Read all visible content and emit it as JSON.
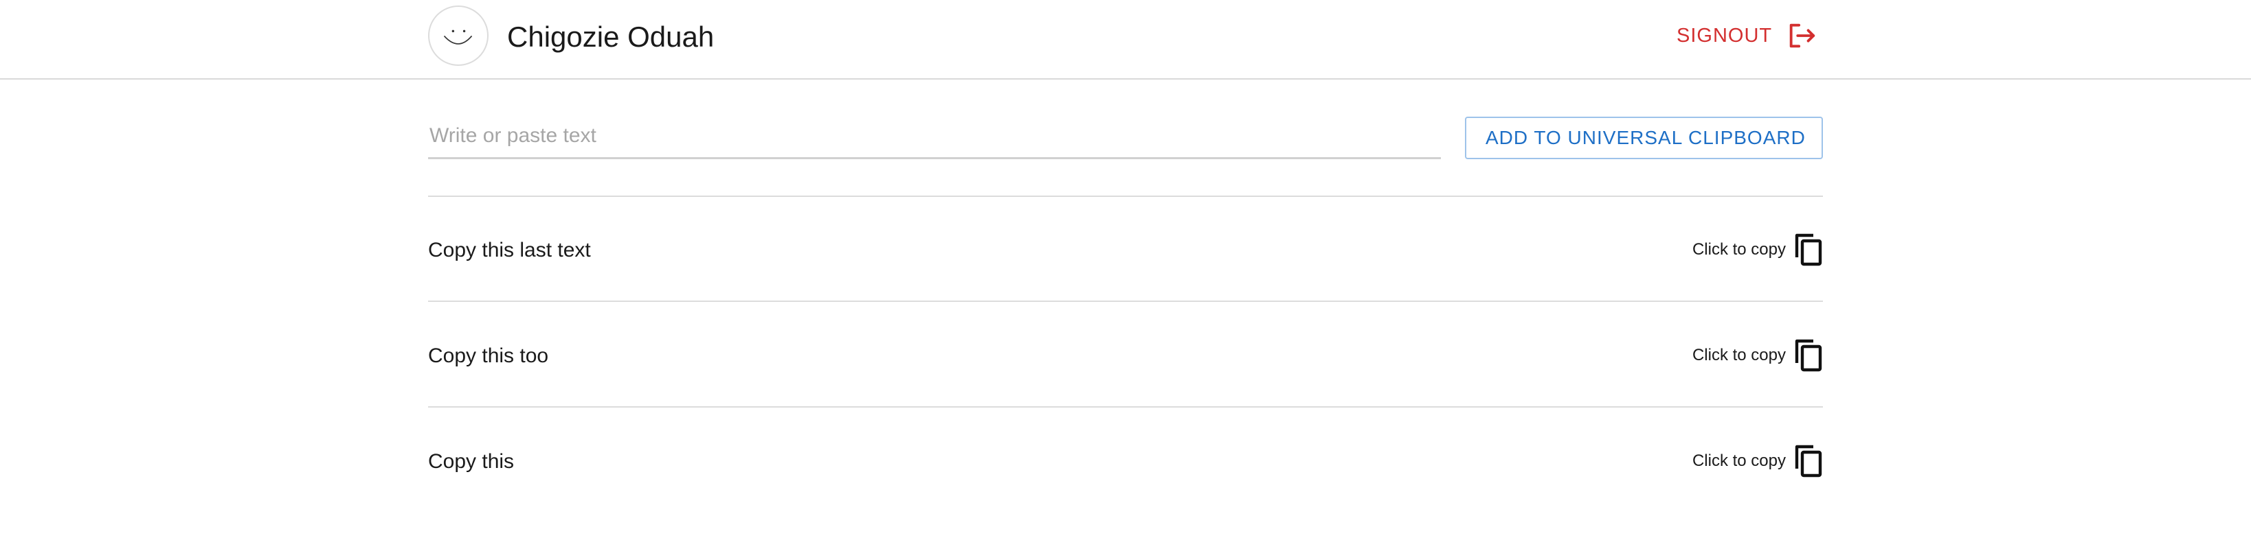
{
  "header": {
    "user_name": "Chigozie Oduah",
    "avatar_icon": "smiley-face-icon",
    "signout_label": "SIGNOUT",
    "signout_icon": "logout-icon",
    "signout_color": "#d32f2f"
  },
  "composer": {
    "placeholder": "Write or paste text",
    "value": "",
    "add_button_label": "ADD TO UNIVERSAL CLIPBOARD",
    "add_button_icon": "download-icon",
    "accent_color": "#1e6fc6"
  },
  "clipboard": {
    "copy_icon": "copy-icon",
    "items": [
      {
        "text": "Copy this last text",
        "action_label": "Click to copy"
      },
      {
        "text": "Copy this too",
        "action_label": "Click to copy"
      },
      {
        "text": "Copy this",
        "action_label": "Click to copy"
      }
    ]
  }
}
